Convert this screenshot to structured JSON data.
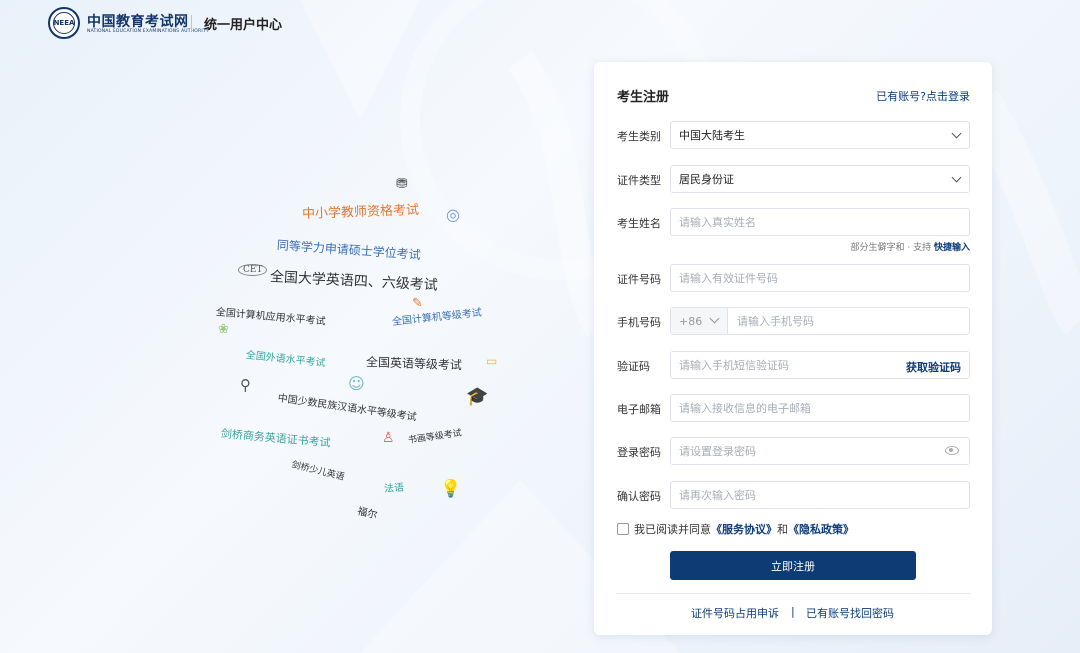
{
  "header": {
    "logo_text": "中国教育考试网",
    "logo_sub": "NATIONAL EDUCATION EXAMINATIONS AUTHORITY",
    "emblem_text": "NEEA",
    "title": "统一用户中心"
  },
  "cloud": {
    "words": [
      "中小学教师资格考试",
      "同等学力申请硕士学位考试",
      "全国大学英语四、六级考试",
      "CET",
      "全国计算机应用水平考试",
      "全国计算机等级考试",
      "全国外语水平考试",
      "全国英语等级考试",
      "中国少数民族汉语水平等级考试",
      "剑桥商务英语证书考试",
      "书画等级考试",
      "剑桥少儿英语",
      "法语",
      "福尔"
    ]
  },
  "form": {
    "title": "考生注册",
    "login_link": "已有账号?点击登录",
    "category": {
      "label": "考生类别",
      "value": "中国大陆考生"
    },
    "id_type": {
      "label": "证件类型",
      "value": "居民身份证"
    },
    "name": {
      "label": "考生姓名",
      "placeholder": "请输入真实姓名"
    },
    "hint": {
      "text": "部分生僻字和 · 支持",
      "link": "快捷输入"
    },
    "id_number": {
      "label": "证件号码",
      "placeholder": "请输入有效证件号码"
    },
    "phone": {
      "label": "手机号码",
      "prefix": "+86",
      "placeholder": "请输入手机号码"
    },
    "code": {
      "label": "验证码",
      "placeholder": "请输入手机短信验证码",
      "action": "获取验证码"
    },
    "email": {
      "label": "电子邮箱",
      "placeholder": "请输入接收信息的电子邮箱"
    },
    "password": {
      "label": "登录密码",
      "placeholder": "请设置登录密码"
    },
    "confirm": {
      "label": "确认密码",
      "placeholder": "请再次输入密码"
    },
    "agree": {
      "prefix": "我已阅读并同意",
      "service": "《服务协议》",
      "and": "和",
      "privacy": "《隐私政策》"
    },
    "submit": "立即注册",
    "footer_left": "证件号码占用申诉",
    "footer_sep": "|",
    "footer_right": "已有账号找回密码"
  },
  "colors": {
    "brand": "#0e3b73",
    "link": "#0e3d7a",
    "orange": "#e8772e",
    "teal": "#3aa5a0",
    "blue": "#3b6fb8"
  },
  "icons": [
    "dropdown-chevron-icon",
    "eye-icon",
    "magnifier-icon",
    "bulb-icon",
    "stamp-icon",
    "graduation-cap-icon"
  ]
}
